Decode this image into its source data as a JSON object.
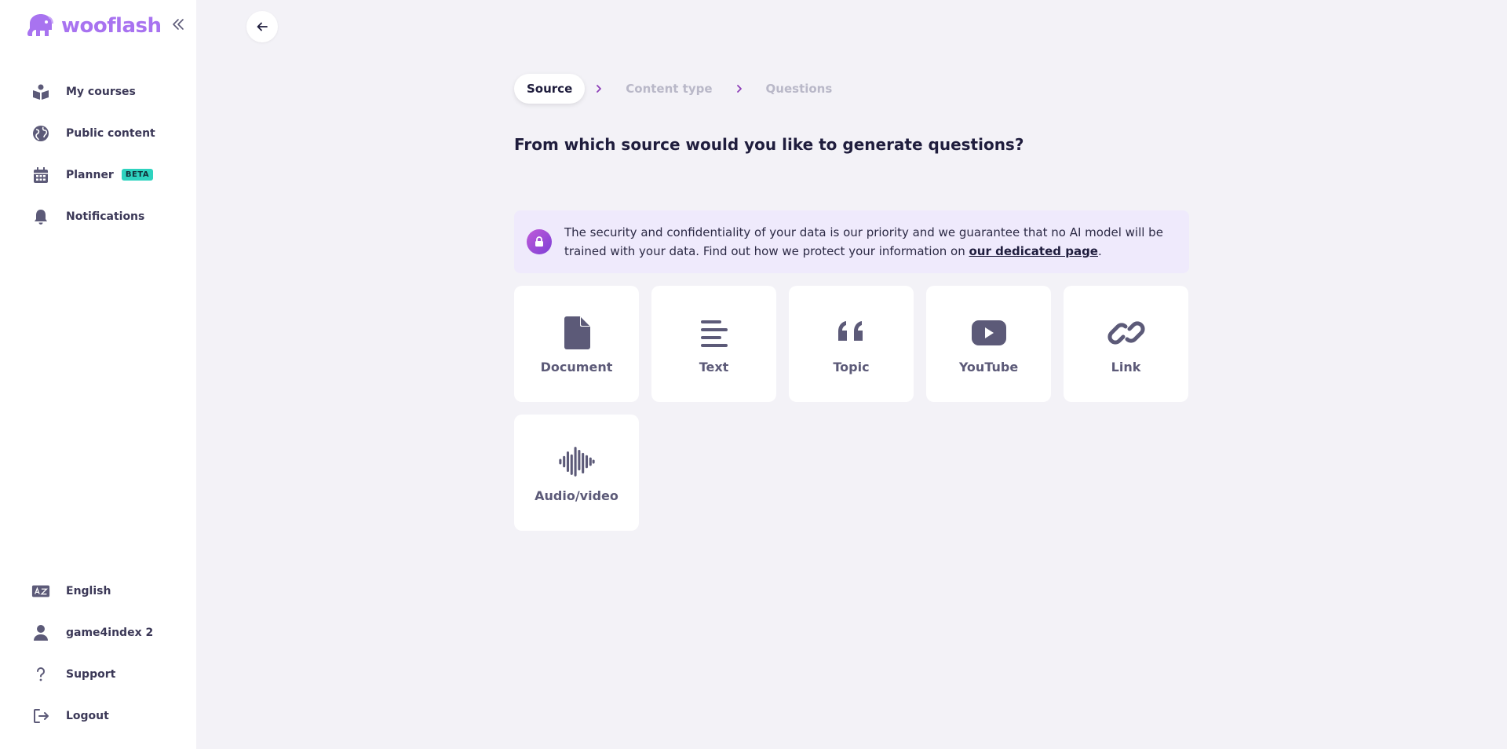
{
  "app": {
    "name": "wooflash"
  },
  "sidebar": {
    "items": [
      {
        "label": "My courses",
        "icon": "book-reader-icon"
      },
      {
        "label": "Public content",
        "icon": "globe-icon"
      },
      {
        "label": "Planner",
        "icon": "calendar-icon",
        "badge": "BETA"
      },
      {
        "label": "Notifications",
        "icon": "bell-icon"
      }
    ],
    "bottom": [
      {
        "label": "English",
        "icon": "language-icon"
      },
      {
        "label": "game4index 2",
        "icon": "user-icon"
      },
      {
        "label": "Support",
        "icon": "question-icon"
      },
      {
        "label": "Logout",
        "icon": "logout-icon"
      }
    ]
  },
  "stepper": {
    "steps": [
      "Source",
      "Content type",
      "Questions"
    ],
    "active": 0
  },
  "main": {
    "title": "From which source would you like to generate questions?",
    "notice": {
      "text": "The security and confidentiality of your data is our priority and we guarantee that no AI model will be trained with your data. Find out how we protect your information on ",
      "link": "our dedicated page",
      "suffix": "."
    },
    "sources": [
      {
        "label": "Document",
        "icon": "file-icon"
      },
      {
        "label": "Text",
        "icon": "text-align-icon"
      },
      {
        "label": "Topic",
        "icon": "quote-icon"
      },
      {
        "label": "YouTube",
        "icon": "youtube-icon"
      },
      {
        "label": "Link",
        "icon": "link-icon"
      },
      {
        "label": "Audio/video",
        "icon": "waveform-icon"
      }
    ]
  },
  "colors": {
    "brand": "#a873f0",
    "icon": "#5c5a78",
    "badge": "#2ed3bf",
    "background": "#f3f2f7",
    "notice_bg": "#efeafc"
  }
}
